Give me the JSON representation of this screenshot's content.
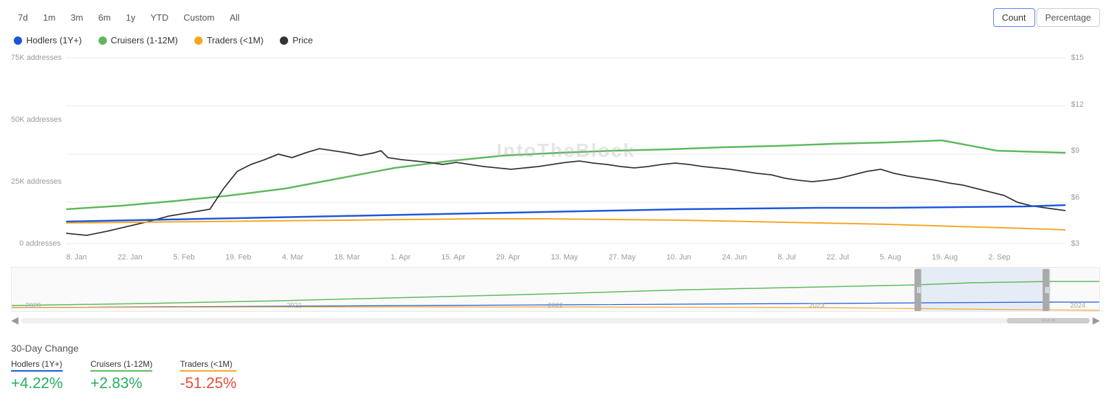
{
  "toolbar": {
    "time_buttons": [
      {
        "label": "7d",
        "id": "7d",
        "active": false
      },
      {
        "label": "1m",
        "id": "1m",
        "active": false
      },
      {
        "label": "3m",
        "id": "3m",
        "active": false
      },
      {
        "label": "6m",
        "id": "6m",
        "active": false
      },
      {
        "label": "1y",
        "id": "1y",
        "active": false
      },
      {
        "label": "YTD",
        "id": "ytd",
        "active": false
      },
      {
        "label": "Custom",
        "id": "custom",
        "active": false
      },
      {
        "label": "All",
        "id": "all",
        "active": false
      }
    ],
    "view_count_label": "Count",
    "view_percentage_label": "Percentage"
  },
  "legend": [
    {
      "label": "Hodlers (1Y+)",
      "color": "#1a56db",
      "dot_color": "#1a56db"
    },
    {
      "label": "Cruisers (1-12M)",
      "color": "#5cb85c",
      "dot_color": "#5cb85c"
    },
    {
      "label": "Traders (<1M)",
      "color": "#f5a623",
      "dot_color": "#f5a623"
    },
    {
      "label": "Price",
      "color": "#333",
      "dot_color": "#333"
    }
  ],
  "y_axis_left": [
    "75K addresses",
    "50K addresses",
    "25K addresses",
    "0 addresses"
  ],
  "y_axis_right": [
    "$15",
    "$12",
    "$9",
    "$6",
    "$3"
  ],
  "x_axis": [
    "8. Jan",
    "22. Jan",
    "5. Feb",
    "19. Feb",
    "4. Mar",
    "18. Mar",
    "1. Apr",
    "15. Apr",
    "29. Apr",
    "13. May",
    "27. May",
    "10. Jun",
    "24. Jun",
    "8. Jul",
    "22. Jul",
    "5. Aug",
    "19. Aug",
    "2. Sep"
  ],
  "navigator": {
    "year_labels": [
      "2020",
      "2021",
      "2022",
      "2023",
      "2024"
    ]
  },
  "watermark": "IntoTheBlock",
  "change_section": {
    "title": "30-Day Change",
    "items": [
      {
        "label": "Hodlers (1Y+)",
        "value": "+4.22%",
        "type": "positive",
        "border_color": "#1a56db"
      },
      {
        "label": "Cruisers (1-12M)",
        "value": "+2.83%",
        "type": "positive",
        "border_color": "#5cb85c"
      },
      {
        "label": "Traders (<1M)",
        "value": "-51.25%",
        "type": "negative",
        "border_color": "#f5a623"
      }
    ]
  }
}
